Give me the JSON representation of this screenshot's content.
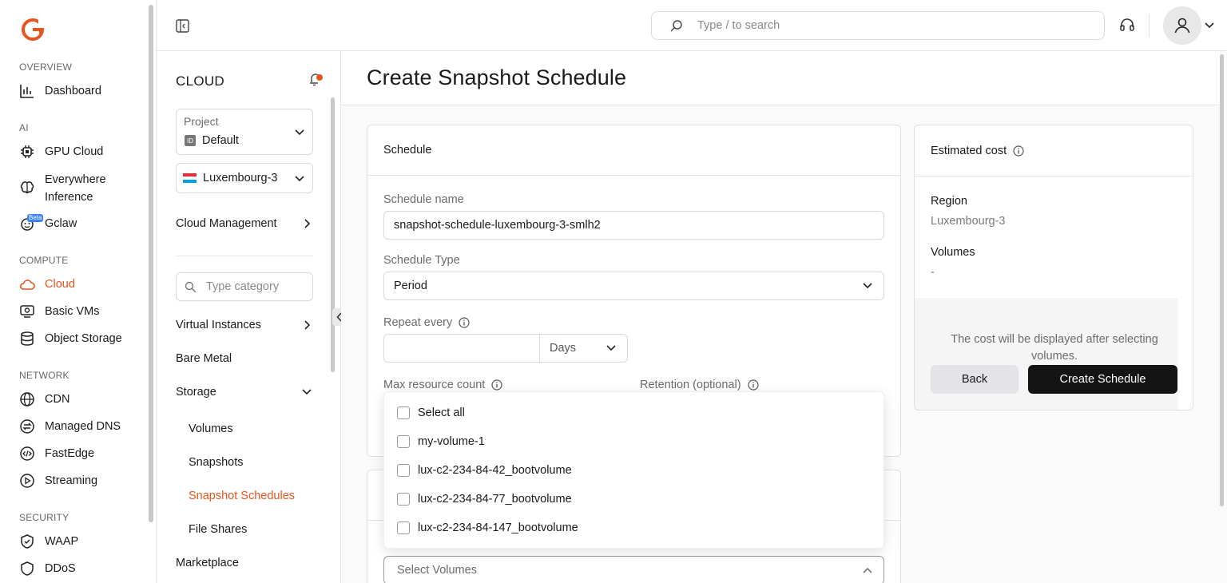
{
  "colors": {
    "accent": "#e8541e",
    "primary_button": "#141414",
    "secondary_button": "#e4e4e8"
  },
  "header": {
    "search_placeholder": "Type / to search",
    "search_icon": "search-icon",
    "support_icon": "headset-icon",
    "user_icon": "user-icon"
  },
  "leftnav": {
    "sections": {
      "overview": "OVERVIEW",
      "ai": "AI",
      "compute": "COMPUTE",
      "network": "NETWORK",
      "security": "SECURITY"
    },
    "items": {
      "dashboard": "Dashboard",
      "gpu_cloud": "GPU Cloud",
      "everywhere_line1": "Everywhere",
      "everywhere_line2": "Inference",
      "gclaw": "Gclaw",
      "gclaw_badge": "Beta",
      "cloud": "Cloud",
      "basic_vms": "Basic VMs",
      "object_storage": "Object Storage",
      "cdn": "CDN",
      "managed_dns": "Managed DNS",
      "fastedge": "FastEdge",
      "streaming": "Streaming",
      "waap": "WAAP",
      "ddos": "DDoS"
    }
  },
  "subnav": {
    "title": "CLOUD",
    "project_label": "Project",
    "project_badge": "ID",
    "project_value": "Default",
    "region_value": "Luxembourg-3",
    "cloud_management": "Cloud Management",
    "category_placeholder": "Type category",
    "virtual_instances": "Virtual Instances",
    "bare_metal": "Bare Metal",
    "storage": "Storage",
    "volumes": "Volumes",
    "snapshots": "Snapshots",
    "snapshot_schedules": "Snapshot Schedules",
    "file_shares": "File Shares",
    "marketplace": "Marketplace"
  },
  "main": {
    "title": "Create Snapshot Schedule",
    "schedule_panel": {
      "heading": "Schedule",
      "name_label": "Schedule name",
      "name_value": "snapshot-schedule-luxembourg-3-smlh2",
      "type_label": "Schedule Type",
      "type_value": "Period",
      "repeat_label": "Repeat every",
      "repeat_value": "",
      "repeat_unit": "Days",
      "max_label": "Max resource count",
      "retention_label": "Retention (optional)"
    },
    "volumes_select_placeholder": "Select Volumes",
    "dropdown_options": [
      "Select all",
      "my-volume-1",
      "lux-c2-234-84-42_bootvolume",
      "lux-c2-234-84-77_bootvolume",
      "lux-c2-234-84-147_bootvolume"
    ]
  },
  "cost": {
    "heading": "Estimated cost",
    "region_label": "Region",
    "region_value": "Luxembourg-3",
    "volumes_label": "Volumes",
    "volumes_value": "-",
    "note": "The cost will be displayed after selecting volumes.",
    "back_label": "Back",
    "create_label": "Create Schedule"
  }
}
